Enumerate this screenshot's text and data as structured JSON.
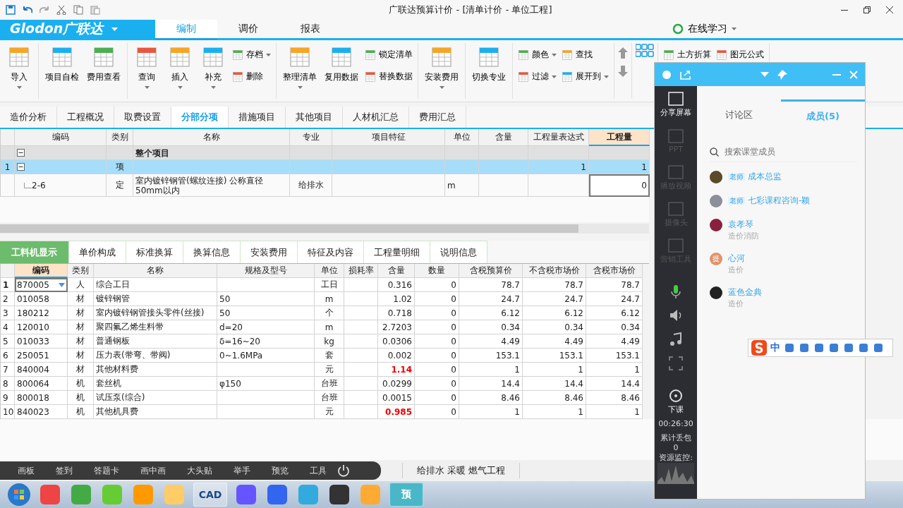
{
  "title_bar": {
    "title": "广联达预算计价 - [清单计价 - 单位工程]"
  },
  "brand": {
    "logo": "Glodon广联达"
  },
  "menu_tabs": [
    {
      "label": "编制",
      "selected": true
    },
    {
      "label": "调价",
      "selected": false
    },
    {
      "label": "报表",
      "selected": false
    }
  ],
  "online": {
    "label": "在线学习"
  },
  "toolbar": [
    {
      "items": [
        {
          "kind": "large",
          "label": "导入",
          "dropdown": true
        }
      ]
    },
    {
      "items": [
        {
          "kind": "large",
          "label": "项目自检",
          "dropdown": false
        },
        {
          "kind": "large",
          "label": "费用查看",
          "dropdown": false
        }
      ]
    },
    {
      "items": [
        {
          "kind": "large",
          "label": "查询",
          "dropdown": true
        },
        {
          "kind": "large",
          "label": "插入",
          "dropdown": true
        },
        {
          "kind": "large",
          "label": "补充",
          "dropdown": true
        },
        {
          "kind": "pair",
          "items": [
            {
              "label": "存档",
              "dropdown": true
            },
            {
              "label": "删除",
              "dropdown": false
            }
          ]
        }
      ]
    },
    {
      "items": [
        {
          "kind": "large",
          "label": "整理清单",
          "dropdown": true
        },
        {
          "kind": "large",
          "label": "复用数据",
          "dropdown": false
        },
        {
          "kind": "pair",
          "items": [
            {
              "label": "锁定清单",
              "dropdown": false
            },
            {
              "label": "替换数据",
              "dropdown": false
            }
          ]
        }
      ]
    },
    {
      "items": [
        {
          "kind": "large",
          "label": "安装费用",
          "dropdown": true
        }
      ]
    },
    {
      "items": [
        {
          "kind": "large",
          "label": "切换专业",
          "dropdown": false
        }
      ]
    },
    {
      "items": [
        {
          "kind": "pair",
          "items": [
            {
              "label": "颜色",
              "dropdown": true
            },
            {
              "label": "过滤",
              "dropdown": true
            }
          ]
        },
        {
          "kind": "pair",
          "items": [
            {
              "label": "查找",
              "dropdown": false
            },
            {
              "label": "展开到",
              "dropdown": true
            }
          ]
        }
      ]
    },
    {
      "items": [
        {
          "kind": "arrows"
        }
      ]
    },
    {
      "items": [
        {
          "kind": "grid"
        }
      ]
    },
    {
      "items": [
        {
          "kind": "pair",
          "items": [
            {
              "label": "土方折算",
              "dropdown": false
            }
          ]
        },
        {
          "kind": "pair",
          "items": [
            {
              "label": "图元公式",
              "dropdown": false
            }
          ]
        }
      ]
    }
  ],
  "sheet_tabs": [
    {
      "label": "造价分析",
      "selected": false
    },
    {
      "label": "工程概况",
      "selected": false
    },
    {
      "label": "取费设置",
      "selected": false
    },
    {
      "label": "分部分项",
      "selected": true
    },
    {
      "label": "措施项目",
      "selected": false
    },
    {
      "label": "其他项目",
      "selected": false
    },
    {
      "label": "人材机汇总",
      "selected": false
    },
    {
      "label": "费用汇总",
      "selected": false
    }
  ],
  "upper_table": {
    "columns": [
      {
        "label": "编码",
        "selected": false
      },
      {
        "label": "类别",
        "selected": false
      },
      {
        "label": "名称",
        "selected": false
      },
      {
        "label": "专业",
        "selected": false
      },
      {
        "label": "项目特征",
        "selected": false
      },
      {
        "label": "单位",
        "selected": false
      },
      {
        "label": "含量",
        "selected": false
      },
      {
        "label": "工程量表达式",
        "selected": false
      },
      {
        "label": "工程量",
        "selected": true
      }
    ],
    "rows": [
      {
        "kind": "group",
        "selected": false,
        "expanded": true,
        "name": "整个项目"
      },
      {
        "kind": "item",
        "selected": true,
        "expanded": true,
        "num": "1",
        "type": "项",
        "expr": "1",
        "qty": "1"
      },
      {
        "kind": "sub",
        "selected": false,
        "code": "2-6",
        "type": "定",
        "name": "室内镀锌钢管(螺纹连接) 公称直径50mm以内",
        "major": "给排水",
        "unit": "m",
        "qty": "0"
      }
    ]
  },
  "lower_tabs": [
    {
      "label": "工料机显示",
      "selected": true
    },
    {
      "label": "单价构成",
      "selected": false
    },
    {
      "label": "标准换算",
      "selected": false
    },
    {
      "label": "换算信息",
      "selected": false
    },
    {
      "label": "安装费用",
      "selected": false
    },
    {
      "label": "特征及内容",
      "selected": false
    },
    {
      "label": "工程量明细",
      "selected": false
    },
    {
      "label": "说明信息",
      "selected": false
    }
  ],
  "lower_table": {
    "columns": [
      {
        "label": "编码",
        "selected": true
      },
      {
        "label": "类别",
        "selected": false
      },
      {
        "label": "名称",
        "selected": false
      },
      {
        "label": "规格及型号",
        "selected": false
      },
      {
        "label": "单位",
        "selected": false
      },
      {
        "label": "损耗率",
        "selected": false
      },
      {
        "label": "含量",
        "selected": false
      },
      {
        "label": "数量",
        "selected": false
      },
      {
        "label": "含税预算价",
        "selected": false
      },
      {
        "label": "不含税市场价",
        "selected": false
      },
      {
        "label": "含税市场价",
        "selected": false
      }
    ],
    "rows": [
      {
        "num": "1",
        "selected": true,
        "alert": false,
        "code": "870005",
        "type": "人",
        "name": "综合工日",
        "unit": "工日",
        "content": "0.316",
        "qty": "0",
        "budget": "78.7",
        "market_ex": "78.7",
        "market_in": "78.7"
      },
      {
        "num": "2",
        "selected": false,
        "alert": false,
        "code": "010058",
        "type": "材",
        "name": "镀锌钢管",
        "spec": "50",
        "unit": "m",
        "content": "1.02",
        "qty": "0",
        "budget": "24.7",
        "market_ex": "24.7",
        "market_in": "24.7"
      },
      {
        "num": "3",
        "selected": false,
        "alert": false,
        "code": "180212",
        "type": "材",
        "name": "室内镀锌钢管接头零件(丝接)",
        "spec": "50",
        "unit": "个",
        "content": "0.718",
        "qty": "0",
        "budget": "6.12",
        "market_ex": "6.12",
        "market_in": "6.12"
      },
      {
        "num": "4",
        "selected": false,
        "alert": false,
        "code": "120010",
        "type": "材",
        "name": "聚四氟乙烯生料带",
        "spec": "d=20",
        "unit": "m",
        "content": "2.7203",
        "qty": "0",
        "budget": "0.34",
        "market_ex": "0.34",
        "market_in": "0.34"
      },
      {
        "num": "5",
        "selected": false,
        "alert": false,
        "code": "010033",
        "type": "材",
        "name": "普通钢板",
        "spec": "δ=16~20",
        "unit": "kg",
        "content": "0.0306",
        "qty": "0",
        "budget": "4.49",
        "market_ex": "4.49",
        "market_in": "4.49"
      },
      {
        "num": "6",
        "selected": false,
        "alert": false,
        "code": "250051",
        "type": "材",
        "name": "压力表(带弯、带阀)",
        "spec": "0~1.6MPa",
        "unit": "套",
        "content": "0.002",
        "qty": "0",
        "budget": "153.1",
        "market_ex": "153.1",
        "market_in": "153.1"
      },
      {
        "num": "7",
        "selected": false,
        "alert": true,
        "code": "840004",
        "type": "材",
        "name": "其他材料费",
        "unit": "元",
        "content": "1.14",
        "qty": "0",
        "budget": "1",
        "market_ex": "1",
        "market_in": "1"
      },
      {
        "num": "8",
        "selected": false,
        "alert": false,
        "code": "800064",
        "type": "机",
        "name": "套丝机",
        "spec": "φ150",
        "unit": "台班",
        "content": "0.0299",
        "qty": "0",
        "budget": "14.4",
        "market_ex": "14.4",
        "market_in": "14.4"
      },
      {
        "num": "9",
        "selected": false,
        "alert": false,
        "code": "800018",
        "type": "机",
        "name": "试压泵(综合)",
        "unit": "台班",
        "content": "0.0015",
        "qty": "0",
        "budget": "8.46",
        "market_ex": "8.46",
        "market_in": "8.46"
      },
      {
        "num": "10",
        "selected": false,
        "alert": true,
        "code": "840023",
        "type": "机",
        "name": "其他机具费",
        "unit": "元",
        "content": "0.985",
        "qty": "0",
        "budget": "1",
        "market_ex": "1",
        "market_in": "1"
      }
    ]
  },
  "classroom_bar": {
    "items": [
      "画板",
      "签到",
      "答题卡",
      "画中画",
      "大头贴",
      "举手",
      "预览",
      "工具"
    ]
  },
  "status": {
    "text": "给排水 采暖 燃气工程"
  },
  "taskbar": {
    "labels": [
      "CAD",
      "预"
    ]
  },
  "panel": {
    "sidebar": [
      {
        "label": "分享屏幕",
        "enabled": true
      },
      {
        "label": "PPT",
        "enabled": false
      },
      {
        "label": "播放视频",
        "enabled": false
      },
      {
        "label": "摄像头",
        "enabled": false
      },
      {
        "label": "营销工具",
        "enabled": false
      }
    ],
    "end_class": "下课",
    "timer": "00:26:30",
    "packet_loss_label": "累计丢包",
    "packet_loss": "0",
    "monitor_label": "资源监控:",
    "tabs": [
      {
        "label": "讨论区",
        "selected": false
      },
      {
        "label": "成员(5)",
        "selected": true
      }
    ],
    "search": {
      "placeholder": "搜索课堂成员"
    },
    "members": [
      {
        "name": "成本总监",
        "badge": "老师",
        "color": "#5a4a2a"
      },
      {
        "name": "七彩课程咨询-颖",
        "badge": "老师",
        "color": "#8a8f9a"
      },
      {
        "name": "袁孝琴",
        "subtitle": "造价消防",
        "color": "#8a2040"
      },
      {
        "name": "心河",
        "subtitle": "造价",
        "avatar_text": "提",
        "color": "#e0946a"
      },
      {
        "name": "蓝色金典",
        "subtitle": "造价",
        "color": "#222222"
      }
    ]
  },
  "ime_bar": {
    "mode": "中"
  }
}
